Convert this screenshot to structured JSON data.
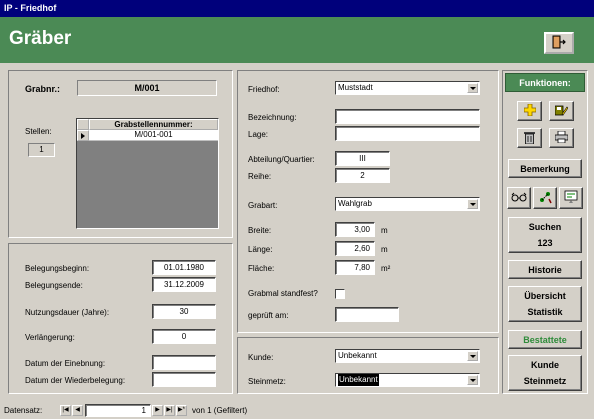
{
  "window": {
    "title": "IP - Friedhof"
  },
  "header": {
    "title": "Gräber",
    "exit_icon": "exit-door-icon"
  },
  "grab": {
    "grabnr_label": "Grabnr.:",
    "grabnr_value": "M/001",
    "stellen_label": "Stellen:",
    "stellen_value": "1",
    "subform_header": "Grabstellennummer:",
    "subform_rows": [
      "M/001-001"
    ]
  },
  "belegung": {
    "beginn_label": "Belegungsbeginn:",
    "beginn_value": "01.01.1980",
    "ende_label": "Belegungsende:",
    "ende_value": "31.12.2009",
    "nutzungsdauer_label": "Nutzungsdauer (Jahre):",
    "nutzungsdauer_value": "30",
    "verlaengerung_label": "Verlängerung:",
    "verlaengerung_value": "0",
    "einebnung_label": "Datum der Einebnung:",
    "einebnung_value": "",
    "wiederbelegung_label": "Datum der Wiederbelegung:",
    "wiederbelegung_value": ""
  },
  "details": {
    "friedhof_label": "Friedhof:",
    "friedhof_value": "Muststadt",
    "bezeichnung_label": "Bezeichnung:",
    "bezeichnung_value": "",
    "lage_label": "Lage:",
    "lage_value": "",
    "abteilung_label": "Abteilung/Quartier:",
    "abteilung_value": "III",
    "reihe_label": "Reihe:",
    "reihe_value": "2",
    "grabart_label": "Grabart:",
    "grabart_value": "Wahlgrab",
    "breite_label": "Breite:",
    "breite_value": "3,00",
    "breite_unit": "m",
    "laenge_label": "Länge:",
    "laenge_value": "2,60",
    "laenge_unit": "m",
    "flaeche_label": "Fläche:",
    "flaeche_value": "7,80",
    "flaeche_unit": "m²",
    "grabmal_label": "Grabmal standfest?",
    "geprueft_label": "geprüft am:",
    "geprueft_value": ""
  },
  "kunde": {
    "kunde_label": "Kunde:",
    "kunde_value": "Unbekannt",
    "steinmetz_label": "Steinmetz:",
    "steinmetz_value": "Unbekannt"
  },
  "functions": {
    "title": "Funktionen:",
    "bemerkung": "Bemerkung",
    "suchen": "Suchen",
    "suchen_sub": "123",
    "historie": "Historie",
    "uebersicht": "Übersicht",
    "statistik": "Statistik",
    "bestattete": "Bestattete",
    "kunde": "Kunde",
    "steinmetz": "Steinmetz",
    "green": "#4b8a55",
    "bestattete_color": "#2e8b3a"
  },
  "nav": {
    "label": "Datensatz:",
    "current": "1",
    "total_text": "von 1 (Gefiltert)"
  }
}
